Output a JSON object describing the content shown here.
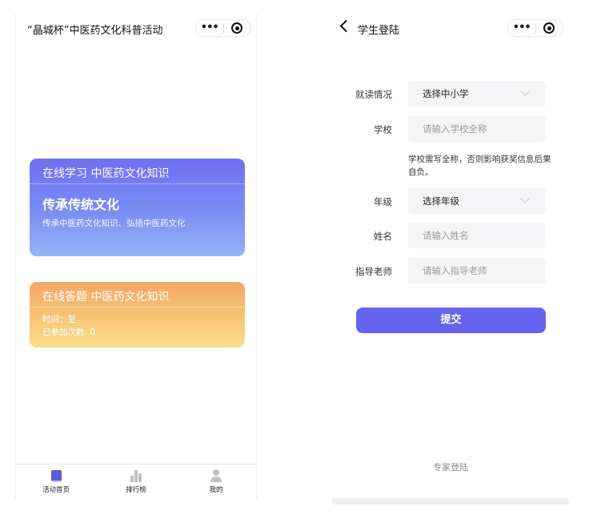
{
  "left": {
    "title": "“晶城杯”中医药文化科普活动",
    "capsule": {
      "more": "•••"
    },
    "study_card": {
      "head": "在线学习 中医药文化知识",
      "big": "传承传统文化",
      "sub": "传承中医药文化知识、弘扬中医药文化"
    },
    "quiz_card": {
      "head": "在线答题 中医药文化知识",
      "time": "时间：至",
      "count": "已参加次数: 0"
    },
    "tabs": [
      {
        "label": "活动首页",
        "icon": "book-icon"
      },
      {
        "label": "排行榜",
        "icon": "rank-icon"
      },
      {
        "label": "我的",
        "icon": "user-icon"
      }
    ]
  },
  "right": {
    "title": "学生登陆",
    "capsule": {
      "more": "•••"
    },
    "form": {
      "school_type": {
        "label": "就读情况",
        "value": "选择中小学"
      },
      "school": {
        "label": "学校",
        "placeholder": "请输入学校全称"
      },
      "school_hint": "学校需写全称，否则影响获奖信息后果自负。",
      "grade": {
        "label": "年级",
        "value": "选择年级"
      },
      "name": {
        "label": "姓名",
        "placeholder": "请输入姓名"
      },
      "teacher": {
        "label": "指导老师",
        "placeholder": "请输入指导老师"
      }
    },
    "submit_label": "提交",
    "expert_login": "专家登陆"
  },
  "colors": {
    "accent": "#6563f0",
    "study_gradient_top": "#6f6ff2",
    "quiz_gradient_top": "#f2a765"
  }
}
